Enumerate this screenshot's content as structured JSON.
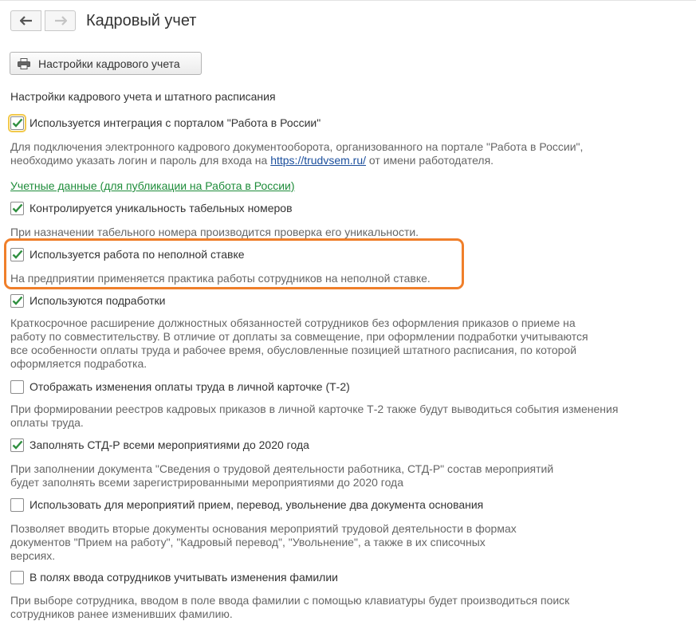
{
  "window": {
    "title": "Кадровый учет"
  },
  "toolbar": {
    "settings_button_label": "Настройки кадрового учета"
  },
  "section": {
    "title": "Настройки кадрового учета и штатного расписания"
  },
  "options": [
    {
      "label": "Используется интеграция с порталом \"Работа в России\"",
      "checked": true,
      "description_before_link": "Для подключения электронного кадрового документооборота, организованного на портале \"Работа в России\",\nнеобходимо указать логин и пароль для входа на ",
      "description_link": "https://trudvsem.ru/",
      "description_after_link": " от имени работодателя."
    },
    {
      "label": "Контролируется уникальность табельных номеров",
      "checked": true,
      "description": "При назначении табельного номера производится проверка его уникальности."
    },
    {
      "label": "Используется работа по неполной ставке",
      "checked": true,
      "description": "На предприятии применяется практика работы сотрудников на неполной ставке."
    },
    {
      "label": "Используются подработки",
      "checked": true,
      "description": "Краткосрочное расширение должностных обязанностей сотрудников без оформления приказов о приеме на\nработу по совместительству. В отличие от доплаты за совмещение, при оформлении подработки учитываются\nвсе особенности оплаты труда и рабочее время, обусловленные позицией штатного расписания, по которой\nоформляется подработка."
    },
    {
      "label": "Отображать изменения оплаты труда в личной карточке (Т-2)",
      "checked": false,
      "description": "При формировании реестров кадровых приказов в личной карточке Т-2 также будут выводиться события изменения\nоплаты труда."
    },
    {
      "label": "Заполнять СТД-Р всеми мероприятиями до 2020 года",
      "checked": true,
      "description": "При заполнении документа \"Сведения о трудовой деятельности работника, СТД-Р\" состав мероприятий\nбудет заполнять всеми зарегистрированными мероприятиями до 2020 года"
    },
    {
      "label": "Использовать для мероприятий прием, перевод, увольнение два документа основания",
      "checked": false,
      "description": "Позволяет вводить вторые документы основания мероприятий трудовой деятельности в формах\nдокументов \"Прием на работу\", \"Кадровый перевод\", \"Увольнение\", а также в их списочных\nверсиях."
    },
    {
      "label": "В полях ввода сотрудников учитывать изменения фамилии",
      "checked": false,
      "description": "При выборе сотрудника, вводом в поле ввода фамилии с помощью клавиатуры будет производиться поиск\nсотрудников ранее изменивших фамилию."
    }
  ],
  "links": {
    "credentials": "Учетные данные (для публикации на Работа в России)"
  },
  "colors": {
    "check": "#2f8f3f",
    "highlight_border": "#f07f2a",
    "link_green": "#1e8c3a",
    "link_blue": "#1a4e9c"
  },
  "icons": {
    "back": "arrow-left-icon",
    "forward": "arrow-right-icon",
    "settings": "printer-icon",
    "check": "checkmark-icon"
  }
}
